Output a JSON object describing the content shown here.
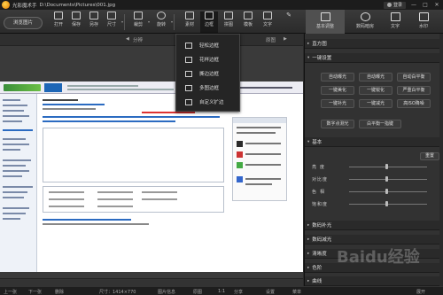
{
  "titlebar": {
    "app_name": "光影魔术手",
    "file_path": "D:\\Documents\\Pictures\\001.jpg",
    "login_label": "登录",
    "min": "—",
    "max": "□",
    "close": "✕"
  },
  "toolbar": {
    "browse_label": "浏览图片",
    "tools": [
      {
        "label": "打开",
        "icon": "folder-open-icon"
      },
      {
        "label": "保存",
        "icon": "save-icon"
      },
      {
        "label": "另存",
        "icon": "save-as-icon"
      },
      {
        "label": "尺寸",
        "icon": "resize-icon"
      },
      {
        "label": "裁剪",
        "icon": "crop-icon"
      },
      {
        "label": "旋转",
        "icon": "rotate-icon"
      },
      {
        "label": "素材",
        "icon": "material-icon"
      },
      {
        "label": "边框",
        "icon": "frame-icon"
      },
      {
        "label": "拼图",
        "icon": "collage-icon"
      },
      {
        "label": "模板",
        "icon": "template-icon"
      },
      {
        "label": "文字",
        "icon": "text-icon"
      }
    ],
    "right_tabs": [
      {
        "label": "基本调整",
        "icon": "adjust-icon"
      },
      {
        "label": "数码暗房",
        "icon": "darkroom-icon"
      },
      {
        "label": "文字",
        "icon": "text-icon"
      },
      {
        "label": "水印",
        "icon": "watermark-icon"
      }
    ]
  },
  "workhead": {
    "prev_label": "分辨",
    "next_label": "原图"
  },
  "dropdown": {
    "items": [
      "轻松边框",
      "花样边框",
      "撕边边框",
      "多图边框",
      "自定义扩边"
    ]
  },
  "panel": {
    "sections": {
      "histogram": "直方图",
      "one_click": "一键设置",
      "basic": "基本",
      "digital_fill": "数码补光",
      "digital_reduce": "数码减光",
      "sharpen": "清晰度",
      "color_scale": "色阶",
      "curves": "曲线"
    },
    "one_click_buttons": [
      "自动曝光",
      "自动曝光",
      "自动白平衡",
      "一键美化",
      "一键锐化",
      "严重白平衡",
      "一键补光",
      "一键减光",
      "高ISO降噪",
      "数字点测光",
      "白平衡一指键"
    ],
    "reset_label": "重置",
    "sliders": [
      {
        "label": "亮度",
        "value": 0.5
      },
      {
        "label": "对比度",
        "value": 0.5
      },
      {
        "label": "色相",
        "value": 0.5
      },
      {
        "label": "饱和度",
        "value": 0.5
      }
    ]
  },
  "bottombar": {
    "prev": "上一张",
    "next": "下一张",
    "delete": "删除",
    "size": "尺寸：1414×770",
    "info": "图片信息",
    "original": "原图",
    "ratio": "1:1",
    "share": "分享",
    "settings": "设置",
    "menu": "菜单",
    "expand": "展开"
  },
  "watermark": "Baidu经验"
}
